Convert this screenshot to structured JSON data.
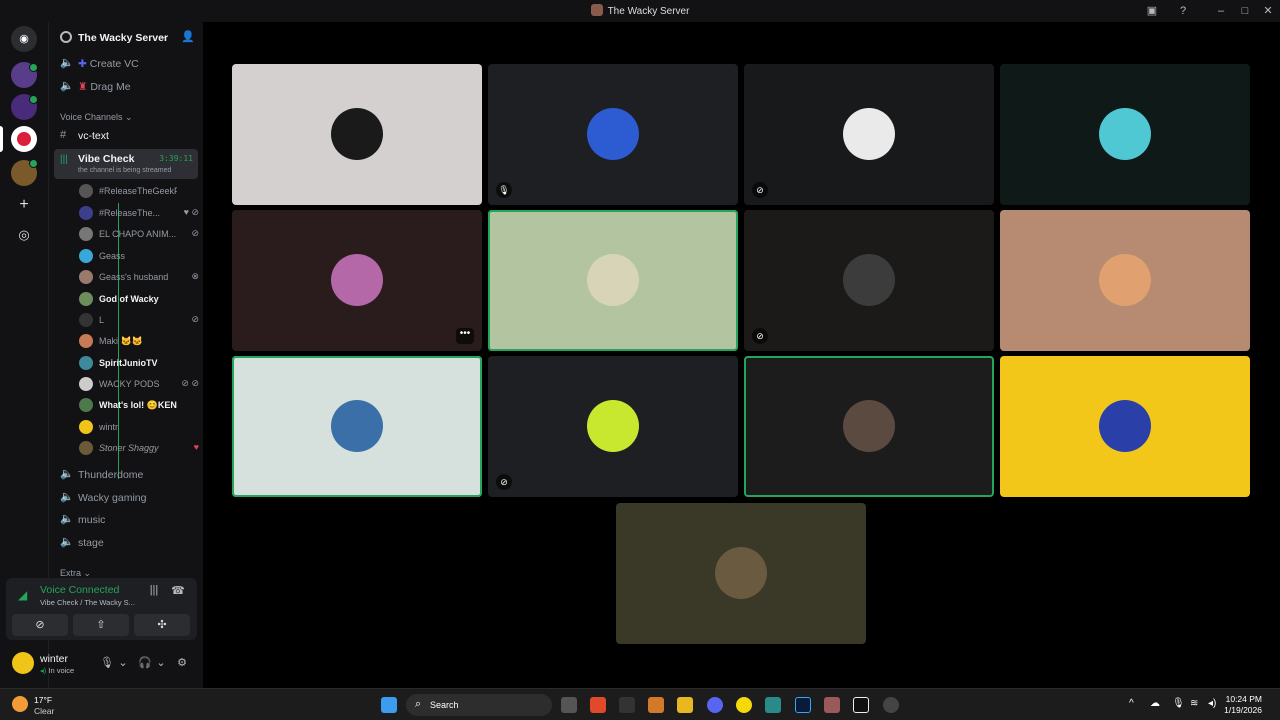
{
  "window": {
    "title": "The Wacky Server"
  },
  "server": {
    "name": "The Wacky Server"
  },
  "channels_top": [
    {
      "label": "Create VC"
    },
    {
      "label": "Drag Me"
    }
  ],
  "categories": {
    "voice": "Voice Channels ⌄",
    "extra": "Extra ⌄"
  },
  "text_channel": {
    "label": "vc-text"
  },
  "active_voice": {
    "label": "Vibe Check",
    "timer": "3:39:11",
    "subtitle": "the channel is being streamed"
  },
  "voice_users": [
    {
      "name": "#ReleaseTheGeekFiles",
      "status": "",
      "color": "#555"
    },
    {
      "name": "#ReleaseThe...",
      "status": "♥ ⊘",
      "color": "#3b3f8c"
    },
    {
      "name": "EL CHAPO ANIM...",
      "status": "⊘",
      "color": "#777"
    },
    {
      "name": "Geass",
      "status": "",
      "color": "#3aa7d9"
    },
    {
      "name": "Geass's husband",
      "status": "⊗",
      "color": "#9a7a6a"
    },
    {
      "name": "God of Wacky",
      "status": "",
      "color": "#6b8e5a"
    },
    {
      "name": "L",
      "status": "⊘",
      "color": "#333"
    },
    {
      "name": "Maki 🐱🐱",
      "status": "",
      "color": "#c77a55"
    },
    {
      "name": "SpiritJunioTV",
      "status": "",
      "color": "#3e8a9a"
    },
    {
      "name": "WACKY PODS",
      "status": "⊘ ⊘",
      "color": "#ccc"
    },
    {
      "name": "What's lol! 😊KEN",
      "status": "",
      "color": "#4c7a4c"
    },
    {
      "name": "wintr",
      "status": "",
      "color": "#f0c419"
    },
    {
      "name": "Stoner Shaggy",
      "status": "♥",
      "color": "#6a5a3a"
    }
  ],
  "channels_bottom": [
    {
      "label": "Thunderdome"
    },
    {
      "label": "Wacky gaming"
    },
    {
      "label": "music"
    },
    {
      "label": "stage"
    }
  ],
  "voice_panel": {
    "status": "Voice Connected",
    "location": "Vibe Check / The Wacky S..."
  },
  "user_panel": {
    "name": "winter",
    "status": "In voice"
  },
  "tiles": [
    {
      "bg": "#d4d0d0",
      "av": "#1a1a1a",
      "icon": "",
      "speaking": false
    },
    {
      "bg": "#1e1f22",
      "av": "#2d5bd1",
      "icon": "🎙",
      "speaking": false
    },
    {
      "bg": "#18191b",
      "av": "#eaeaea",
      "icon": "⊘",
      "speaking": false
    },
    {
      "bg": "#0f1a18",
      "av": "#4fc8d4",
      "icon": "",
      "speaking": false
    },
    {
      "bg": "#2a1c1c",
      "av": "#b568a8",
      "icon": "",
      "speaking": false,
      "more": "•••"
    },
    {
      "bg": "#b3c4a0",
      "av": "#d8d4b8",
      "icon": "",
      "speaking": true
    },
    {
      "bg": "#1c1a18",
      "av": "#3c3c3c",
      "icon": "⊘",
      "speaking": false
    },
    {
      "bg": "#b78a72",
      "av": "#e0a070",
      "icon": "",
      "speaking": false
    },
    {
      "bg": "#d6e0dd",
      "av": "#3a6fa8",
      "icon": "",
      "speaking": true
    },
    {
      "bg": "#1e1f22",
      "av": "#c8e830",
      "icon": "⊘",
      "speaking": false
    },
    {
      "bg": "#1c1c1c",
      "av": "#5a4a40",
      "icon": "",
      "speaking": true
    },
    {
      "bg": "#f2c719",
      "av": "#2a40a8",
      "icon": "",
      "speaking": false
    },
    {
      "bg": "#3a3826",
      "av": "#6a5a40",
      "icon": "",
      "speaking": false
    }
  ],
  "taskbar": {
    "temp": "17°F",
    "weather": "Clear",
    "search_placeholder": "Search",
    "time": "10:24 PM",
    "date": "1/19/2026"
  }
}
